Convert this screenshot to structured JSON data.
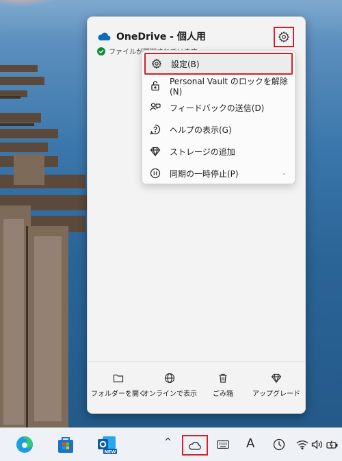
{
  "onedrive": {
    "title": "OneDrive - 個人用",
    "status": "ファイルが同期されています"
  },
  "menu": {
    "items": [
      {
        "label": "設定(B)",
        "icon": "gear-icon"
      },
      {
        "label": "Personal Vault のロックを解除(N)",
        "icon": "lock-icon"
      },
      {
        "label": "フィードバックの送信(D)",
        "icon": "feedback-icon"
      },
      {
        "label": "ヘルプの表示(G)",
        "icon": "help-icon"
      },
      {
        "label": "ストレージの追加",
        "icon": "diamond-icon"
      },
      {
        "label": "同期の一時停止(P)",
        "icon": "pause-icon",
        "chevron": "⌄"
      }
    ]
  },
  "footer": {
    "buttons": [
      {
        "label": "フォルダーを開く",
        "icon": "folder-icon"
      },
      {
        "label": "オンラインで表示",
        "icon": "globe-icon"
      },
      {
        "label": "ごみ箱",
        "icon": "trash-icon"
      },
      {
        "label": "アップグレード",
        "icon": "diamond-icon"
      }
    ]
  },
  "taskbar": {
    "outlook_badge": "NEW",
    "tray_chevron": "^",
    "ime_label": "A"
  },
  "colors": {
    "highlight": "#d0212c",
    "onedrive_blue": "#0f6cbd",
    "sync_green": "#138a36"
  }
}
